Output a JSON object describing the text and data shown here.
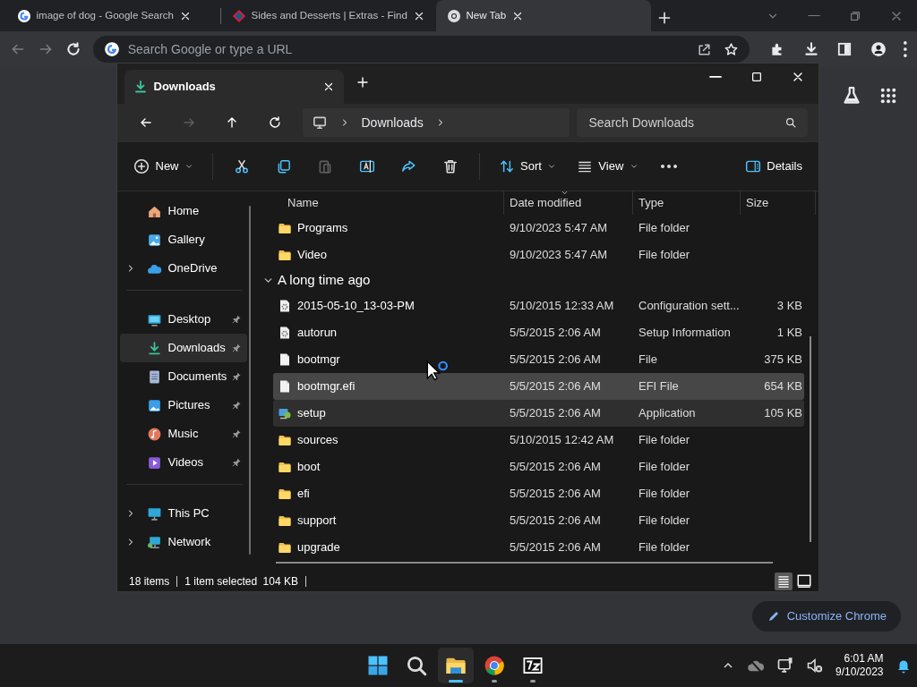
{
  "browser": {
    "tabs": [
      {
        "title": "image of dog - Google Search",
        "selected": false
      },
      {
        "title": "Sides and Desserts | Extras - Find",
        "selected": false
      },
      {
        "title": "New Tab",
        "selected": true
      }
    ],
    "address_bar": {
      "placeholder": "Search Google or type a URL"
    },
    "customize_button": "Customize Chrome"
  },
  "explorer": {
    "tab": "Downloads",
    "breadcrumb": [
      "Downloads"
    ],
    "search": {
      "placeholder": "Search Downloads"
    },
    "nav_buttons": [
      {
        "disabled": false
      },
      {
        "disabled": true
      },
      {
        "disabled": false
      },
      {
        "disabled": false
      }
    ],
    "toolbar": [
      {
        "kind": "menu",
        "label": "New",
        "disabled": false
      },
      {
        "kind": "icon",
        "disabled": false
      },
      {
        "kind": "icon",
        "disabled": false
      },
      {
        "kind": "icon",
        "disabled": true
      },
      {
        "kind": "icon",
        "disabled": false
      },
      {
        "kind": "icon",
        "disabled": false
      },
      {
        "kind": "icon",
        "disabled": false
      },
      {
        "kind": "menu",
        "label": "Sort",
        "disabled": false
      },
      {
        "kind": "menu",
        "label": "View",
        "disabled": false
      },
      {
        "kind": "icon",
        "disabled": false
      },
      {
        "kind": "toggle",
        "label": "Details",
        "disabled": false
      }
    ],
    "sidebar": [
      [
        {
          "label": "Home",
          "expandable": false,
          "pinned": false,
          "selected": false
        },
        {
          "label": "Gallery",
          "expandable": false,
          "pinned": false,
          "selected": false
        },
        {
          "label": "OneDrive",
          "expandable": true,
          "pinned": false,
          "selected": false
        }
      ],
      [
        {
          "label": "Desktop",
          "expandable": false,
          "pinned": true,
          "selected": false
        },
        {
          "label": "Downloads",
          "expandable": false,
          "pinned": true,
          "selected": true
        },
        {
          "label": "Documents",
          "expandable": false,
          "pinned": true,
          "selected": false
        },
        {
          "label": "Pictures",
          "expandable": false,
          "pinned": true,
          "selected": false
        },
        {
          "label": "Music",
          "expandable": false,
          "pinned": true,
          "selected": false
        },
        {
          "label": "Videos",
          "expandable": false,
          "pinned": true,
          "selected": false
        }
      ],
      [
        {
          "label": "This PC",
          "expandable": true,
          "pinned": false,
          "selected": false
        },
        {
          "label": "Network",
          "expandable": true,
          "pinned": false,
          "selected": false
        }
      ]
    ],
    "columns": [
      "Name",
      "Date modified",
      "Type",
      "Size"
    ],
    "rows": [
      {
        "kind": "folder",
        "name": "Programs",
        "date": "9/10/2023 5:47 AM",
        "type": "File folder",
        "selected": false,
        "hovered": false
      },
      {
        "kind": "folder",
        "name": "Video",
        "date": "9/10/2023 5:47 AM",
        "type": "File folder",
        "selected": false,
        "hovered": false
      },
      {
        "kind": "group",
        "label": "A long time ago",
        "expanded": true
      },
      {
        "kind": "config",
        "name": "2015-05-10_13-03-PM",
        "date": "5/10/2015 12:33 AM",
        "type": "Configuration sett...",
        "size": "3 KB",
        "selected": false,
        "hovered": false
      },
      {
        "kind": "config",
        "name": "autorun",
        "date": "5/5/2015 2:06 AM",
        "type": "Setup Information",
        "size": "1 KB",
        "selected": false,
        "hovered": false
      },
      {
        "kind": "file",
        "name": "bootmgr",
        "date": "5/5/2015 2:06 AM",
        "type": "File",
        "size": "375 KB",
        "selected": false,
        "hovered": false
      },
      {
        "kind": "file",
        "name": "bootmgr.efi",
        "date": "5/5/2015 2:06 AM",
        "type": "EFI File",
        "size": "654 KB",
        "selected": false,
        "hovered": true
      },
      {
        "kind": "app",
        "name": "setup",
        "date": "5/5/2015 2:06 AM",
        "type": "Application",
        "size": "105 KB",
        "selected": true,
        "hovered": false
      },
      {
        "kind": "folder",
        "name": "sources",
        "date": "5/10/2015 12:42 AM",
        "type": "File folder",
        "selected": false,
        "hovered": false
      },
      {
        "kind": "folder",
        "name": "boot",
        "date": "5/5/2015 2:06 AM",
        "type": "File folder",
        "selected": false,
        "hovered": false
      },
      {
        "kind": "folder",
        "name": "efi",
        "date": "5/5/2015 2:06 AM",
        "type": "File folder",
        "selected": false,
        "hovered": false
      },
      {
        "kind": "folder",
        "name": "support",
        "date": "5/5/2015 2:06 AM",
        "type": "File folder",
        "selected": false,
        "hovered": false
      },
      {
        "kind": "folder",
        "name": "upgrade",
        "date": "5/5/2015 2:06 AM",
        "type": "File folder",
        "selected": false,
        "hovered": false
      }
    ],
    "status": {
      "count": "18 items",
      "selection": "1 item selected",
      "size": "104 KB"
    },
    "view_modes": [
      {
        "selected": true
      },
      {
        "selected": false
      }
    ]
  },
  "taskbar": {
    "apps": [
      {
        "running": false,
        "active": false
      },
      {
        "running": false,
        "active": false
      },
      {
        "running": true,
        "active": true
      },
      {
        "running": true,
        "active": false
      },
      {
        "running": true,
        "active": false
      }
    ],
    "clock": {
      "time": "6:01 AM",
      "date": "9/10/2023"
    }
  }
}
